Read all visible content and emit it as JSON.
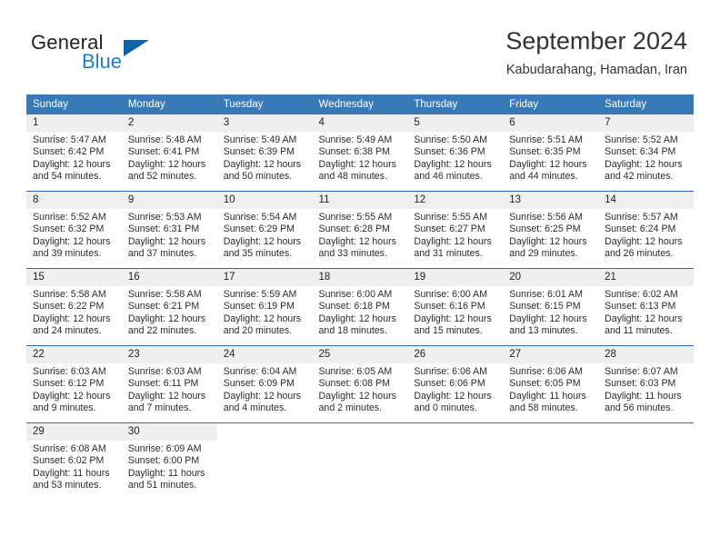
{
  "brand": {
    "name_part1": "General",
    "name_part2": "Blue",
    "triangle_icon": "triangle-icon",
    "accent_blue": "#1a7fd4",
    "dark_blue": "#1262a8"
  },
  "header": {
    "title": "September 2024",
    "subtitle": "Kabudarahang, Hamadan, Iran"
  },
  "colors": {
    "header_row_bg": "#3a79b8",
    "daynum_bg": "#efefef",
    "row_separator": "#2f6eab"
  },
  "weekdays": [
    "Sunday",
    "Monday",
    "Tuesday",
    "Wednesday",
    "Thursday",
    "Friday",
    "Saturday"
  ],
  "weeks": [
    [
      {
        "day": "1",
        "sunrise": "Sunrise: 5:47 AM",
        "sunset": "Sunset: 6:42 PM",
        "daylight_line1": "Daylight: 12 hours",
        "daylight_line2": "and 54 minutes."
      },
      {
        "day": "2",
        "sunrise": "Sunrise: 5:48 AM",
        "sunset": "Sunset: 6:41 PM",
        "daylight_line1": "Daylight: 12 hours",
        "daylight_line2": "and 52 minutes."
      },
      {
        "day": "3",
        "sunrise": "Sunrise: 5:49 AM",
        "sunset": "Sunset: 6:39 PM",
        "daylight_line1": "Daylight: 12 hours",
        "daylight_line2": "and 50 minutes."
      },
      {
        "day": "4",
        "sunrise": "Sunrise: 5:49 AM",
        "sunset": "Sunset: 6:38 PM",
        "daylight_line1": "Daylight: 12 hours",
        "daylight_line2": "and 48 minutes."
      },
      {
        "day": "5",
        "sunrise": "Sunrise: 5:50 AM",
        "sunset": "Sunset: 6:36 PM",
        "daylight_line1": "Daylight: 12 hours",
        "daylight_line2": "and 46 minutes."
      },
      {
        "day": "6",
        "sunrise": "Sunrise: 5:51 AM",
        "sunset": "Sunset: 6:35 PM",
        "daylight_line1": "Daylight: 12 hours",
        "daylight_line2": "and 44 minutes."
      },
      {
        "day": "7",
        "sunrise": "Sunrise: 5:52 AM",
        "sunset": "Sunset: 6:34 PM",
        "daylight_line1": "Daylight: 12 hours",
        "daylight_line2": "and 42 minutes."
      }
    ],
    [
      {
        "day": "8",
        "sunrise": "Sunrise: 5:52 AM",
        "sunset": "Sunset: 6:32 PM",
        "daylight_line1": "Daylight: 12 hours",
        "daylight_line2": "and 39 minutes."
      },
      {
        "day": "9",
        "sunrise": "Sunrise: 5:53 AM",
        "sunset": "Sunset: 6:31 PM",
        "daylight_line1": "Daylight: 12 hours",
        "daylight_line2": "and 37 minutes."
      },
      {
        "day": "10",
        "sunrise": "Sunrise: 5:54 AM",
        "sunset": "Sunset: 6:29 PM",
        "daylight_line1": "Daylight: 12 hours",
        "daylight_line2": "and 35 minutes."
      },
      {
        "day": "11",
        "sunrise": "Sunrise: 5:55 AM",
        "sunset": "Sunset: 6:28 PM",
        "daylight_line1": "Daylight: 12 hours",
        "daylight_line2": "and 33 minutes."
      },
      {
        "day": "12",
        "sunrise": "Sunrise: 5:55 AM",
        "sunset": "Sunset: 6:27 PM",
        "daylight_line1": "Daylight: 12 hours",
        "daylight_line2": "and 31 minutes."
      },
      {
        "day": "13",
        "sunrise": "Sunrise: 5:56 AM",
        "sunset": "Sunset: 6:25 PM",
        "daylight_line1": "Daylight: 12 hours",
        "daylight_line2": "and 29 minutes."
      },
      {
        "day": "14",
        "sunrise": "Sunrise: 5:57 AM",
        "sunset": "Sunset: 6:24 PM",
        "daylight_line1": "Daylight: 12 hours",
        "daylight_line2": "and 26 minutes."
      }
    ],
    [
      {
        "day": "15",
        "sunrise": "Sunrise: 5:58 AM",
        "sunset": "Sunset: 6:22 PM",
        "daylight_line1": "Daylight: 12 hours",
        "daylight_line2": "and 24 minutes."
      },
      {
        "day": "16",
        "sunrise": "Sunrise: 5:58 AM",
        "sunset": "Sunset: 6:21 PM",
        "daylight_line1": "Daylight: 12 hours",
        "daylight_line2": "and 22 minutes."
      },
      {
        "day": "17",
        "sunrise": "Sunrise: 5:59 AM",
        "sunset": "Sunset: 6:19 PM",
        "daylight_line1": "Daylight: 12 hours",
        "daylight_line2": "and 20 minutes."
      },
      {
        "day": "18",
        "sunrise": "Sunrise: 6:00 AM",
        "sunset": "Sunset: 6:18 PM",
        "daylight_line1": "Daylight: 12 hours",
        "daylight_line2": "and 18 minutes."
      },
      {
        "day": "19",
        "sunrise": "Sunrise: 6:00 AM",
        "sunset": "Sunset: 6:16 PM",
        "daylight_line1": "Daylight: 12 hours",
        "daylight_line2": "and 15 minutes."
      },
      {
        "day": "20",
        "sunrise": "Sunrise: 6:01 AM",
        "sunset": "Sunset: 6:15 PM",
        "daylight_line1": "Daylight: 12 hours",
        "daylight_line2": "and 13 minutes."
      },
      {
        "day": "21",
        "sunrise": "Sunrise: 6:02 AM",
        "sunset": "Sunset: 6:13 PM",
        "daylight_line1": "Daylight: 12 hours",
        "daylight_line2": "and 11 minutes."
      }
    ],
    [
      {
        "day": "22",
        "sunrise": "Sunrise: 6:03 AM",
        "sunset": "Sunset: 6:12 PM",
        "daylight_line1": "Daylight: 12 hours",
        "daylight_line2": "and 9 minutes."
      },
      {
        "day": "23",
        "sunrise": "Sunrise: 6:03 AM",
        "sunset": "Sunset: 6:11 PM",
        "daylight_line1": "Daylight: 12 hours",
        "daylight_line2": "and 7 minutes."
      },
      {
        "day": "24",
        "sunrise": "Sunrise: 6:04 AM",
        "sunset": "Sunset: 6:09 PM",
        "daylight_line1": "Daylight: 12 hours",
        "daylight_line2": "and 4 minutes."
      },
      {
        "day": "25",
        "sunrise": "Sunrise: 6:05 AM",
        "sunset": "Sunset: 6:08 PM",
        "daylight_line1": "Daylight: 12 hours",
        "daylight_line2": "and 2 minutes."
      },
      {
        "day": "26",
        "sunrise": "Sunrise: 6:06 AM",
        "sunset": "Sunset: 6:06 PM",
        "daylight_line1": "Daylight: 12 hours",
        "daylight_line2": "and 0 minutes."
      },
      {
        "day": "27",
        "sunrise": "Sunrise: 6:06 AM",
        "sunset": "Sunset: 6:05 PM",
        "daylight_line1": "Daylight: 11 hours",
        "daylight_line2": "and 58 minutes."
      },
      {
        "day": "28",
        "sunrise": "Sunrise: 6:07 AM",
        "sunset": "Sunset: 6:03 PM",
        "daylight_line1": "Daylight: 11 hours",
        "daylight_line2": "and 56 minutes."
      }
    ],
    [
      {
        "day": "29",
        "sunrise": "Sunrise: 6:08 AM",
        "sunset": "Sunset: 6:02 PM",
        "daylight_line1": "Daylight: 11 hours",
        "daylight_line2": "and 53 minutes."
      },
      {
        "day": "30",
        "sunrise": "Sunrise: 6:09 AM",
        "sunset": "Sunset: 6:00 PM",
        "daylight_line1": "Daylight: 11 hours",
        "daylight_line2": "and 51 minutes."
      },
      {
        "day": "",
        "sunrise": "",
        "sunset": "",
        "daylight_line1": "",
        "daylight_line2": ""
      },
      {
        "day": "",
        "sunrise": "",
        "sunset": "",
        "daylight_line1": "",
        "daylight_line2": ""
      },
      {
        "day": "",
        "sunrise": "",
        "sunset": "",
        "daylight_line1": "",
        "daylight_line2": ""
      },
      {
        "day": "",
        "sunrise": "",
        "sunset": "",
        "daylight_line1": "",
        "daylight_line2": ""
      },
      {
        "day": "",
        "sunrise": "",
        "sunset": "",
        "daylight_line1": "",
        "daylight_line2": ""
      }
    ]
  ]
}
